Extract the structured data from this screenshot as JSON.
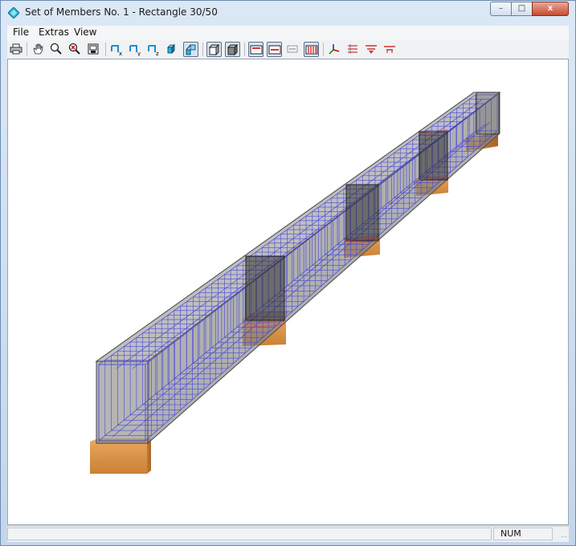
{
  "window": {
    "title": "Set of Members No. 1 - Rectangle 30/50",
    "controls": {
      "minimize": "–",
      "maximize": "□",
      "close": "x"
    }
  },
  "menu": {
    "items": [
      "File",
      "Extras",
      "View"
    ]
  },
  "toolbar": {
    "icons": [
      "printer-icon",
      "pan-hand-icon",
      "zoom-icon",
      "zoom-all-icon",
      "view-settings-icon",
      "view-x-icon",
      "view-y-icon",
      "view-z-icon",
      "isometric-icon",
      "perspective-icon",
      "solid-box-icon",
      "transparent-box-icon",
      "section-top-icon",
      "section-middle-icon",
      "section-bottom-icon",
      "stirrups-icon",
      "axes-icon",
      "dimension-icon",
      "filter-down-icon",
      "filter-up-icon"
    ],
    "active": [
      "perspective-icon"
    ]
  },
  "status": {
    "num": "NUM"
  },
  "colors": {
    "concrete": "#9a9a9a",
    "rebar": "#3b3bdc",
    "support": "#d08a3e",
    "title_bar": "#dbe8f6"
  }
}
